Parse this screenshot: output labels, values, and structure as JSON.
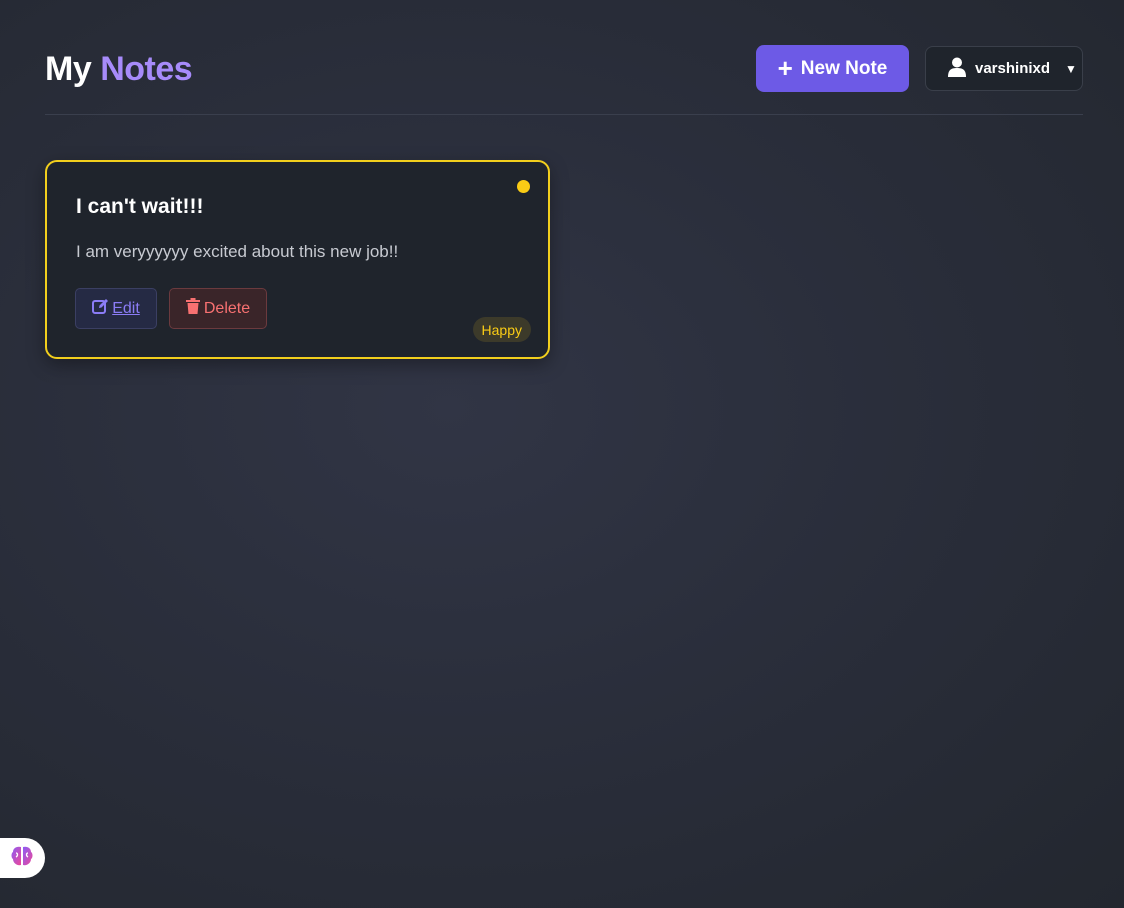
{
  "header": {
    "title_part1": "My",
    "title_part2": "Notes",
    "new_note_label": "New Note",
    "new_note_icon": "plus-icon",
    "user": {
      "icon": "user-icon",
      "name": "varshinixd",
      "caret": "▼"
    }
  },
  "notes": [
    {
      "title": "I can't wait!!!",
      "body": "I am veryyyyyy excited about this new job!!",
      "edit_label": "Edit",
      "delete_label": "Delete",
      "mood": "Happy",
      "mood_color": "#facc15"
    }
  ],
  "colors": {
    "accent": "#6d5ae6",
    "title_accent": "#a78bfa",
    "happy": "#facc15",
    "delete": "#f87171"
  },
  "fab": {
    "icon": "brain-icon"
  }
}
